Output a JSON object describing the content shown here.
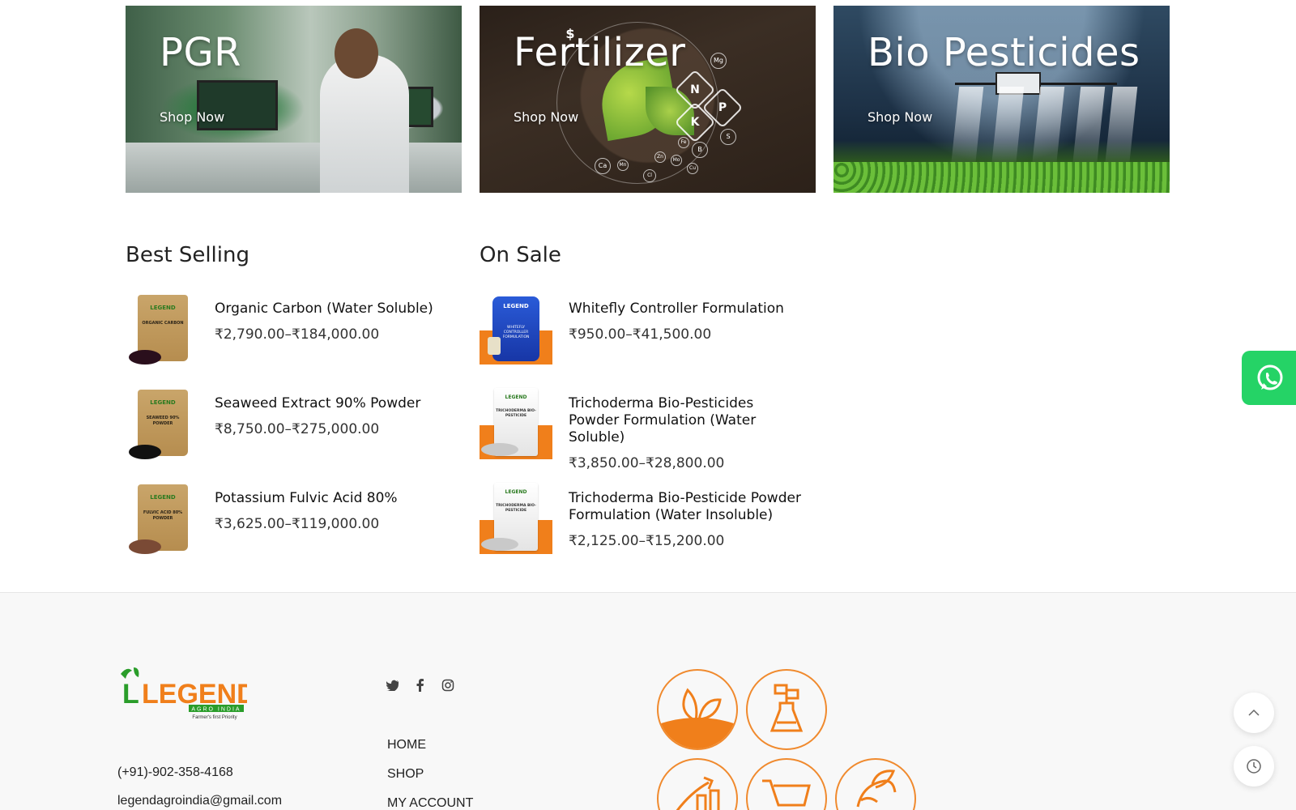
{
  "banners": [
    {
      "title": "PGR",
      "cta": "Shop Now"
    },
    {
      "title": "Fertilizer",
      "cta": "Shop Now"
    },
    {
      "title": "Bio Pesticides",
      "cta": "Shop Now"
    }
  ],
  "fertilizer_graphic": {
    "hex_nutrients": [
      "N",
      "P",
      "K"
    ],
    "symbols": [
      "Mg",
      "S",
      "B",
      "Fe",
      "Zn",
      "Mo",
      "Cu",
      "Cl",
      "Mn",
      "Ca",
      "$"
    ]
  },
  "best_selling": {
    "title": "Best Selling",
    "items": [
      {
        "name": "Organic Carbon (Water Soluble)",
        "price": "₹2,790.00–₹184,000.00",
        "pack_brand": "LEGEND",
        "pack_label": "ORGANIC CARBON",
        "pile_color": "#2a0f1c"
      },
      {
        "name": "Seaweed Extract 90% Powder",
        "price": "₹8,750.00–₹275,000.00",
        "pack_brand": "LEGEND",
        "pack_label": "SEAWEED 90% POWDER",
        "pile_color": "#111111"
      },
      {
        "name": "Potassium Fulvic Acid 80%",
        "price": "₹3,625.00–₹119,000.00",
        "pack_brand": "LEGEND",
        "pack_label": "FULVIC ACID 80% POWDER",
        "pile_color": "#7a4a35"
      }
    ]
  },
  "on_sale": {
    "title": "On Sale",
    "items": [
      {
        "name": "Whitefly Controller Formulation",
        "price": "₹950.00–₹41,500.00",
        "pack_brand": "LEGEND",
        "pack_label": "WHITEFLY CONTROLLER FORMULATION"
      },
      {
        "name": "Trichoderma Bio-Pesticides Powder Formulation (Water Soluble)",
        "price": "₹3,850.00–₹28,800.00",
        "pack_brand": "LEGEND",
        "pack_label": "TRICHODERMA BIO-PESTICIDE"
      },
      {
        "name": "Trichoderma Bio-Pesticide Powder Formulation (Water Insoluble)",
        "price": "₹2,125.00–₹15,200.00",
        "pack_brand": "LEGEND",
        "pack_label": "TRICHODERMA BIO-PESTICIDE"
      }
    ]
  },
  "footer": {
    "logo": {
      "text": "LEGEND",
      "sub": "AGRO INDIA",
      "tagline": "Farmer's first Priority"
    },
    "phone": "(+91)-902-358-4168",
    "email": "legendagroindia@gmail.com",
    "social": [
      "twitter-icon",
      "facebook-icon",
      "instagram-icon"
    ],
    "nav": [
      "HOME",
      "SHOP",
      "MY ACCOUNT"
    ]
  },
  "colors": {
    "accent": "#f07f1b",
    "brand_green": "#2a9d2a",
    "whatsapp": "#25d366"
  }
}
